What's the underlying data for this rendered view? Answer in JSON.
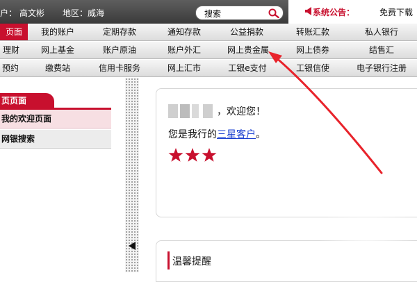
{
  "topbar": {
    "user_prefix": "户：",
    "user_name": "高文彬",
    "region_label": "地区：",
    "region_value": "威海",
    "search_label": "搜索",
    "notice_label": "系统公告：",
    "notice_text": "免费下载"
  },
  "nav": {
    "row1": [
      "页面",
      "我的账户",
      "定期存款",
      "通知存款",
      "公益捐款",
      "转账汇款",
      "私人银行"
    ],
    "row2": [
      "理财",
      "网上基金",
      "账户原油",
      "账户外汇",
      "网上贵金属",
      "网上债券",
      "结售汇"
    ],
    "row3": [
      "预约",
      "缴费站",
      "信用卡服务",
      "网上汇市",
      "工银e支付",
      "工银信使",
      "电子银行注册"
    ],
    "active_item": "页面"
  },
  "left_panel": {
    "tab_label": "页页面",
    "items": [
      "我的欢迎页面",
      "网银搜索"
    ]
  },
  "welcome": {
    "greeting": "，欢迎您！",
    "member_prefix": "您是我行的",
    "member_level": "三星客户",
    "member_suffix": "。",
    "star_count": 3
  },
  "reminder": {
    "title": "温馨提醒"
  },
  "colors": {
    "brand_red": "#c8102e",
    "link_blue": "#1a3fd0",
    "annotation_red": "#e8232b"
  }
}
